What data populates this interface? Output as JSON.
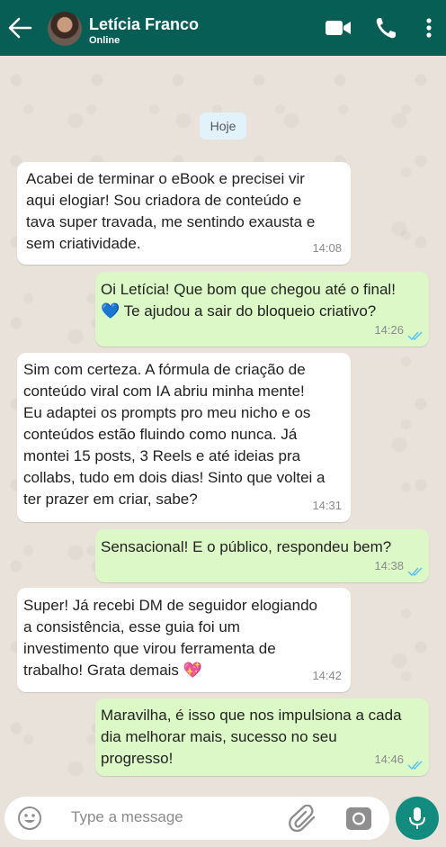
{
  "header": {
    "contact_name": "Letícia Franco",
    "status": "Online"
  },
  "chat": {
    "date_chip": "Hoje",
    "messages": [
      {
        "direction": "in",
        "text": "Acabei de terminar o eBook e precisei vir\naqui elogiar! Sou criadora de conteúdo e\ntava super travada, me sentindo exausta e\nsem criatividade.",
        "time": "14:08"
      },
      {
        "direction": "out",
        "text": "Oi Letícia! Que bom que chegou até o final!\n💙  Te ajudou a sair do bloqueio criativo?",
        "time": "14:26",
        "read": true
      },
      {
        "direction": "in",
        "text": "Sim com certeza. A fórmula de criação de\nconteúdo viral com IA abriu minha mente!\nEu adaptei os prompts pro meu nicho e os\nconteúdos estão fluindo como nunca. Já\nmontei 15 posts, 3 Reels e até ideias pra\ncollabs, tudo em dois dias! Sinto que voltei a\nter prazer em criar, sabe?",
        "time": "14:31"
      },
      {
        "direction": "out",
        "text": "Sensacional! E o público, respondeu bem?",
        "time": "14:38",
        "read": true
      },
      {
        "direction": "in",
        "text": "Super! Já recebi DM de seguidor elogiando\na consistência, esse guia foi um\ninvestimento que virou ferramenta de\ntrabalho! Grata demais 💖",
        "time": "14:42"
      },
      {
        "direction": "out",
        "text": "Maravilha, é isso que nos impulsiona a cada\ndia melhorar mais, sucesso no seu\nprogresso!",
        "time": "14:46",
        "read": true
      }
    ]
  },
  "input": {
    "placeholder": "Type a message"
  },
  "icons": {
    "back": "arrow-left-icon",
    "video": "video-call-icon",
    "phone": "phone-icon",
    "more": "more-vertical-icon",
    "emoji": "emoji-icon",
    "attach": "paperclip-icon",
    "camera": "camera-icon",
    "mic": "microphone-icon",
    "read_receipt": "double-check-icon"
  },
  "colors": {
    "header": "#075e54",
    "outgoing_bubble": "#dcf8c6",
    "incoming_bubble": "#ffffff",
    "read_ticks": "#4fc3f7",
    "mic_button": "#128c7e"
  }
}
